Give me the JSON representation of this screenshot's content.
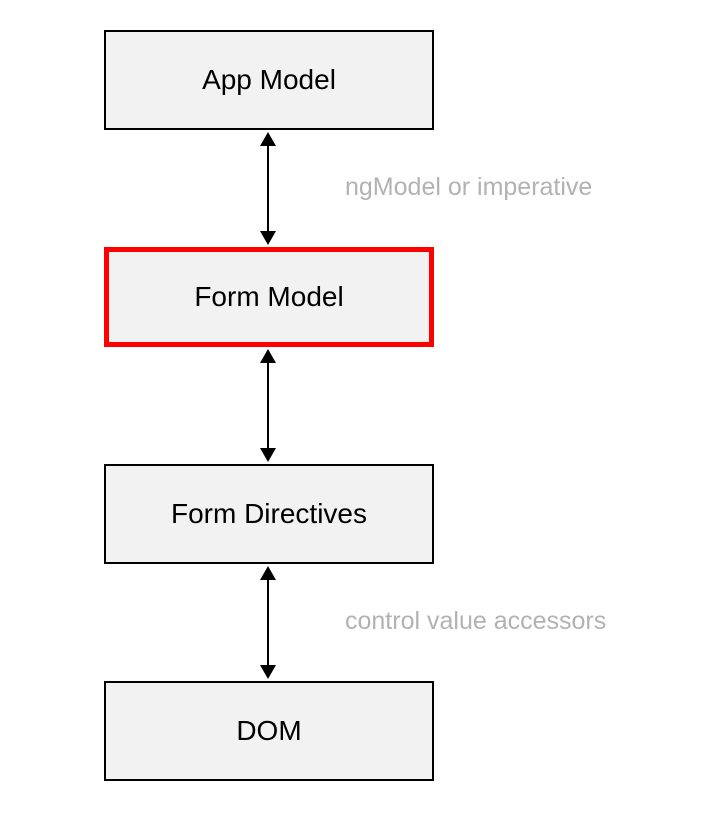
{
  "diagram": {
    "nodes": [
      {
        "id": "app-model",
        "label": "App Model",
        "highlighted": false
      },
      {
        "id": "form-model",
        "label": "Form Model",
        "highlighted": true
      },
      {
        "id": "form-directives",
        "label": "Form Directives",
        "highlighted": false
      },
      {
        "id": "dom",
        "label": "DOM",
        "highlighted": false
      }
    ],
    "edges": [
      {
        "from": "app-model",
        "to": "form-model",
        "label": "ngModel or imperative",
        "bidirectional": true
      },
      {
        "from": "form-model",
        "to": "form-directives",
        "label": "",
        "bidirectional": true
      },
      {
        "from": "form-directives",
        "to": "dom",
        "label": "control value accessors",
        "bidirectional": true
      }
    ],
    "colors": {
      "box_fill": "#f2f2f2",
      "box_border": "#000000",
      "highlight_border": "#ff0000",
      "label_text": "#b2b2b2",
      "node_text": "#000000",
      "arrow": "#000000"
    }
  }
}
